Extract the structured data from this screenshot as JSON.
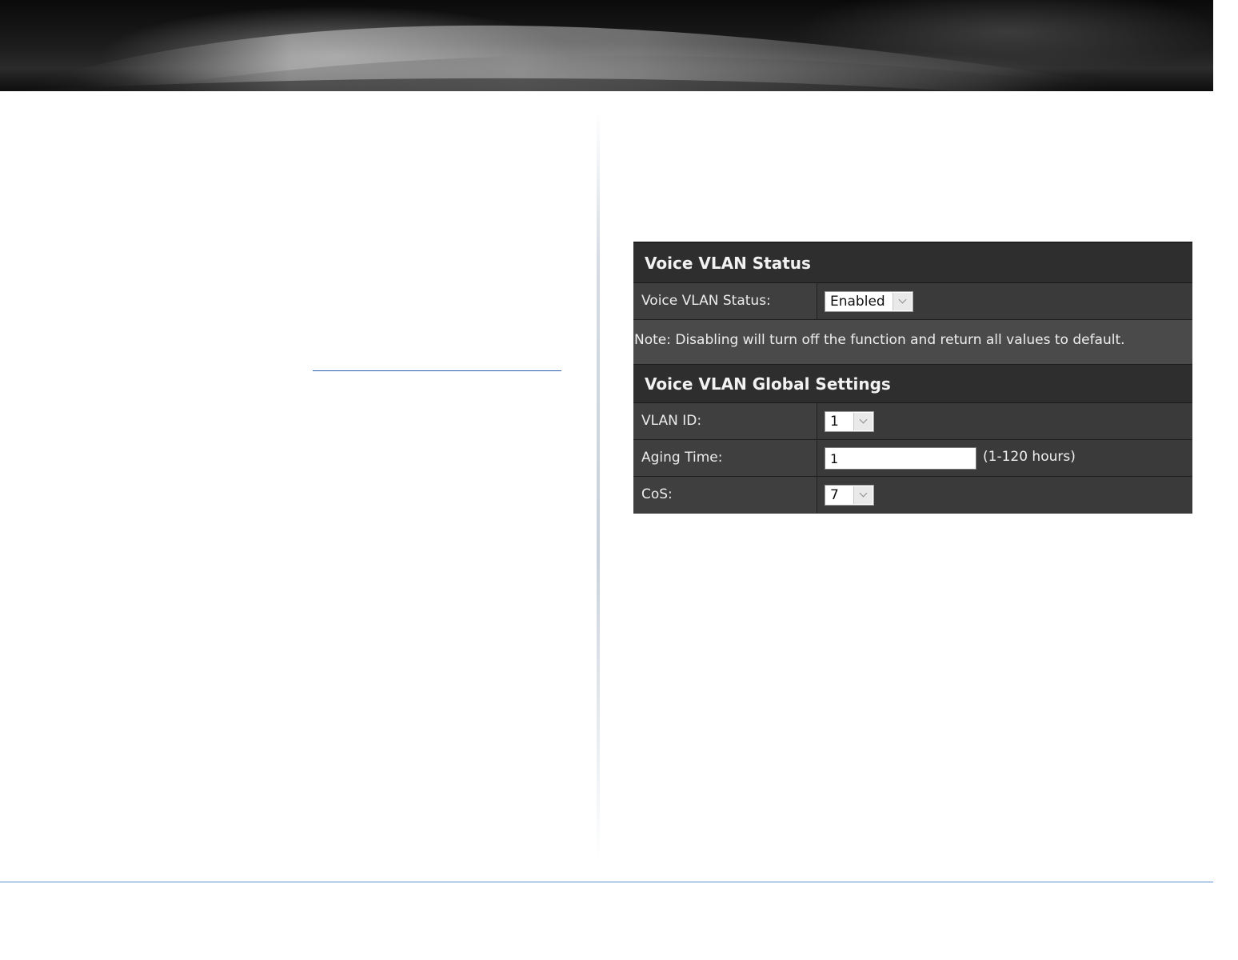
{
  "voice_vlan_status_section": {
    "title": "Voice VLAN Status",
    "status_label": "Voice VLAN Status:",
    "status_value": "Enabled",
    "note": "Note: Disabling will turn off the function and return all values to default."
  },
  "global_settings_section": {
    "title": "Voice VLAN Global Settings",
    "vlan_id_label": "VLAN ID:",
    "vlan_id_value": "1",
    "aging_time_label": "Aging Time:",
    "aging_time_value": "1",
    "aging_time_hint": "(1-120 hours)",
    "cos_label": "CoS:",
    "cos_value": "7"
  }
}
